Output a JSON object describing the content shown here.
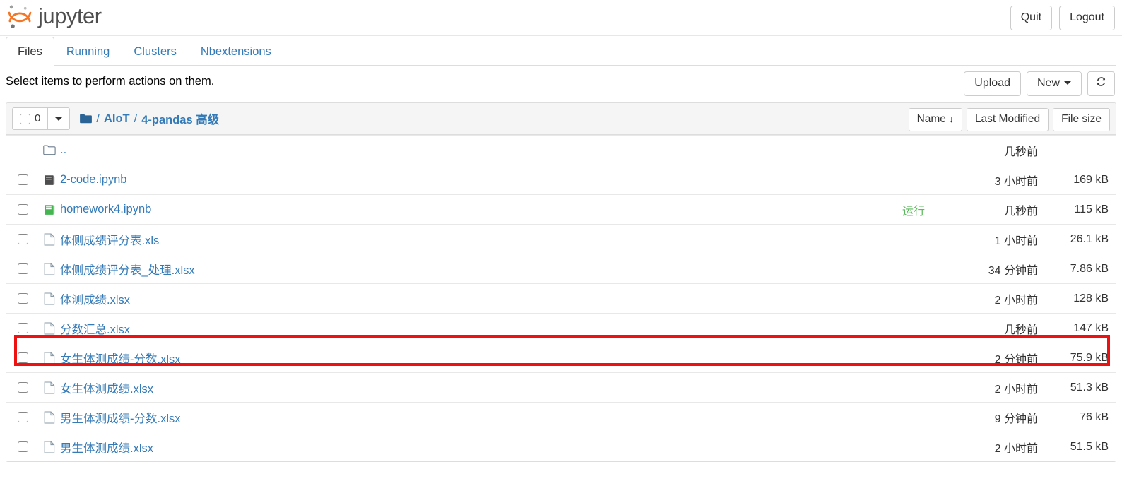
{
  "header": {
    "brand": "jupyter",
    "quit_label": "Quit",
    "logout_label": "Logout"
  },
  "tabs": [
    {
      "label": "Files",
      "active": true
    },
    {
      "label": "Running",
      "active": false
    },
    {
      "label": "Clusters",
      "active": false
    },
    {
      "label": "Nbextensions",
      "active": false
    }
  ],
  "actions": {
    "hint": "Select items to perform actions on them.",
    "upload_label": "Upload",
    "new_label": "New",
    "refresh_icon": "refresh-icon"
  },
  "toolbar": {
    "selected_count": "0",
    "breadcrumb": {
      "root_icon": "folder-icon",
      "separator": "/",
      "items": [
        "AIoT",
        "4-pandas 高级"
      ]
    },
    "sort": {
      "name_label": "Name",
      "name_arrow": "↓",
      "modified_label": "Last Modified",
      "size_label": "File size"
    }
  },
  "files": [
    {
      "icon": "folder-outline-icon",
      "name": "..",
      "running": "",
      "modified": "几秒前",
      "size": "",
      "checkbox": false,
      "type": "parent"
    },
    {
      "icon": "notebook-icon",
      "name": "2-code.ipynb",
      "running": "",
      "modified": "3 小时前",
      "size": "169 kB",
      "checkbox": true,
      "type": "notebook"
    },
    {
      "icon": "notebook-running-icon",
      "name": "homework4.ipynb",
      "running": "运行",
      "modified": "几秒前",
      "size": "115 kB",
      "checkbox": true,
      "type": "notebook-running"
    },
    {
      "icon": "file-icon",
      "name": "体侧成绩评分表.xls",
      "running": "",
      "modified": "1 小时前",
      "size": "26.1 kB",
      "checkbox": true,
      "type": "file"
    },
    {
      "icon": "file-icon",
      "name": "体侧成绩评分表_处理.xlsx",
      "running": "",
      "modified": "34 分钟前",
      "size": "7.86 kB",
      "checkbox": true,
      "type": "file"
    },
    {
      "icon": "file-icon",
      "name": "体测成绩.xlsx",
      "running": "",
      "modified": "2 小时前",
      "size": "128 kB",
      "checkbox": true,
      "type": "file"
    },
    {
      "icon": "file-icon",
      "name": "分数汇总.xlsx",
      "running": "",
      "modified": "几秒前",
      "size": "147 kB",
      "checkbox": true,
      "type": "file",
      "highlighted": true
    },
    {
      "icon": "file-icon",
      "name": "女生体测成绩-分数.xlsx",
      "running": "",
      "modified": "2 分钟前",
      "size": "75.9 kB",
      "checkbox": true,
      "type": "file"
    },
    {
      "icon": "file-icon",
      "name": "女生体测成绩.xlsx",
      "running": "",
      "modified": "2 小时前",
      "size": "51.3 kB",
      "checkbox": true,
      "type": "file"
    },
    {
      "icon": "file-icon",
      "name": "男生体测成绩-分数.xlsx",
      "running": "",
      "modified": "9 分钟前",
      "size": "76 kB",
      "checkbox": true,
      "type": "file"
    },
    {
      "icon": "file-icon",
      "name": "男生体测成绩.xlsx",
      "running": "",
      "modified": "2 小时前",
      "size": "51.5 kB",
      "checkbox": true,
      "type": "file"
    }
  ],
  "colors": {
    "link": "#337ab7",
    "running": "#5cb85c",
    "brand_orange": "#f37726",
    "highlight": "#ee1111"
  }
}
